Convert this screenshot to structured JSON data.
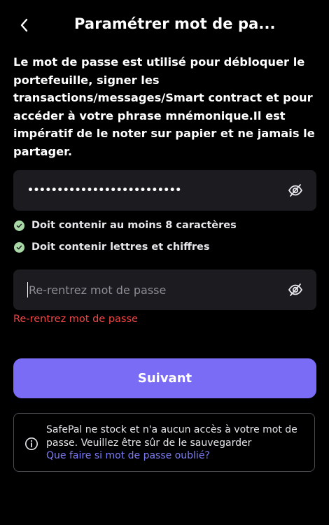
{
  "header": {
    "back_icon": "chevron-left-icon",
    "title": "Paramétrer mot de pa..."
  },
  "description": "Le mot de passe est utilisé pour débloquer le portefeuille, signer les transactions/messages/Smart contract et pour accéder à votre phrase mnémonique.Il est impératif de le noter sur papier et ne jamais le partager.",
  "password_field": {
    "masked_value": "••••••••••••••••••••••••••",
    "eye_icon": "eye-off-icon"
  },
  "rules": [
    {
      "label": "Doit contenir au moins 8 caractères",
      "status": "satisfied"
    },
    {
      "label": "Doit contenir lettres et chiffres",
      "status": "satisfied"
    }
  ],
  "confirm_field": {
    "placeholder": "Re-rentrez mot de passe",
    "eye_icon": "eye-off-icon"
  },
  "error": "Re-rentrez mot de passe",
  "next_button": "Suivant",
  "notice": {
    "icon": "info-icon",
    "text": "SafePal ne stock et n'a aucun accès à votre mot de passe. Veuillez être sûr de le sauvegarder",
    "link": "Que faire si mot de passe oublié?"
  },
  "colors": {
    "background": "#000000",
    "field_background": "#1b1b20",
    "accent": "#7b6cf6",
    "success": "#a8d8a6",
    "error": "#f04444",
    "link": "#7d7cf8"
  }
}
